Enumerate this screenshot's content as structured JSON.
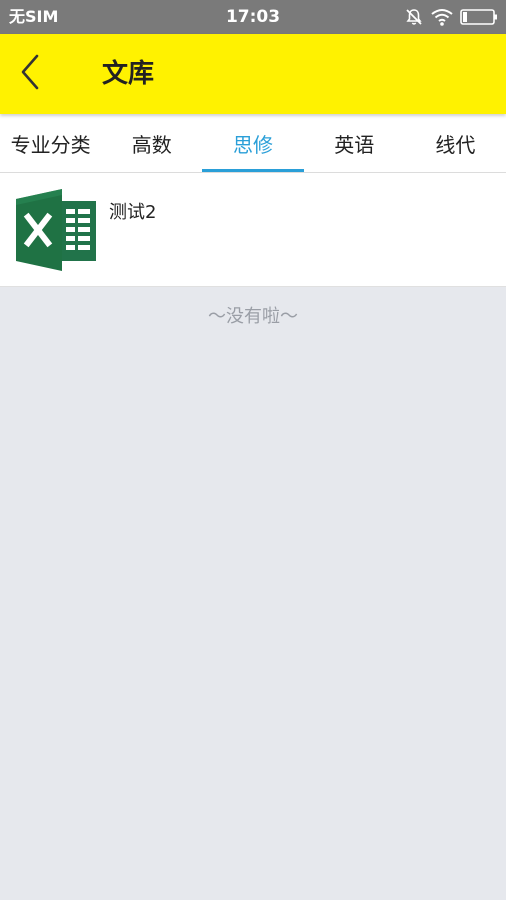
{
  "status_bar": {
    "carrier": "无SIM",
    "time": "17:03",
    "icons": [
      "mute-notification-icon",
      "wifi-icon",
      "battery-icon"
    ]
  },
  "app_bar": {
    "back_icon": "chevron-left-icon",
    "title": "文库",
    "background": "#fff200"
  },
  "tabs": [
    {
      "label": "专业分类",
      "active": false
    },
    {
      "label": "高数",
      "active": false
    },
    {
      "label": "思修",
      "active": true
    },
    {
      "label": "英语",
      "active": false
    },
    {
      "label": "线代",
      "active": false
    }
  ],
  "accent_color": "#2a9fd8",
  "documents": [
    {
      "title": "测试2",
      "icon": "excel-file-icon"
    }
  ],
  "end_of_list": "～没有啦～"
}
